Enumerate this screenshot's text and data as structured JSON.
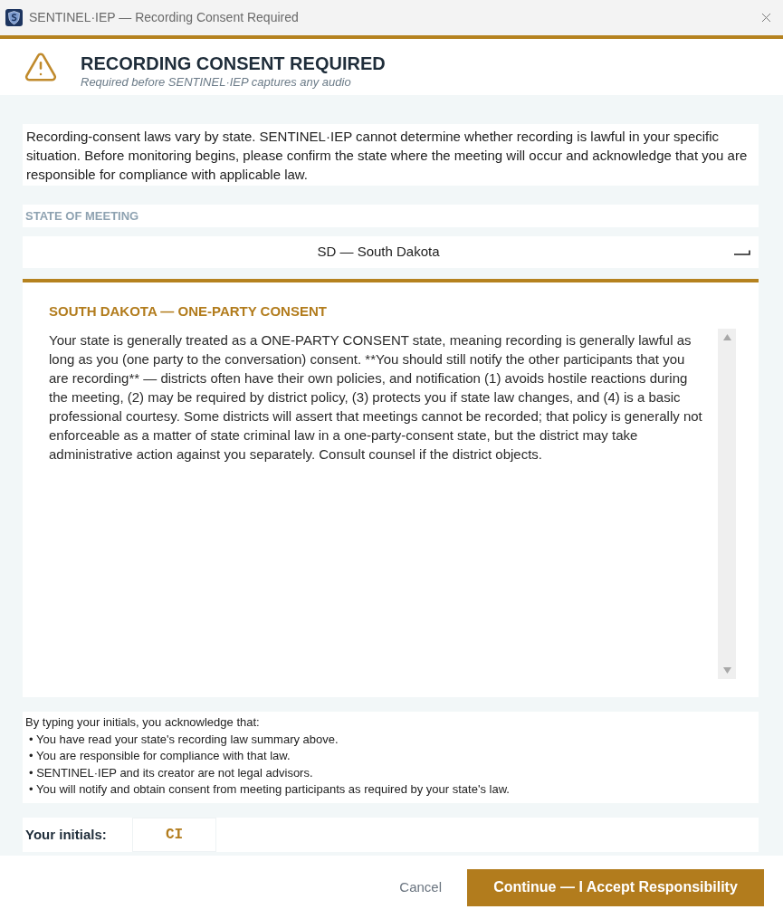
{
  "window": {
    "title": "SENTINEL·IEP — Recording Consent Required"
  },
  "header": {
    "title": "RECORDING CONSENT REQUIRED",
    "subtitle": "Required before SENTINEL·IEP captures any audio"
  },
  "intro": "Recording-consent laws vary by state. SENTINEL·IEP cannot determine whether recording is lawful in your specific situation. Before monitoring begins, please confirm the state where the meeting will occur and acknowledge that you are responsible for compliance with applicable law.",
  "state_field": {
    "label": "STATE OF MEETING",
    "value": "SD — South Dakota"
  },
  "summary": {
    "title": "SOUTH DAKOTA — ONE-PARTY CONSENT",
    "body": "Your state is generally treated as a ONE-PARTY CONSENT state, meaning recording is generally lawful as long as you (one party to the conversation) consent. **You should still notify the other participants that you are recording** — districts often have their own policies, and notification (1) avoids hostile reactions during the meeting, (2) may be required by district policy, (3) protects you if state law changes, and (4) is a basic professional courtesy. Some districts will assert that meetings cannot be recorded; that policy is generally not enforceable as a matter of state criminal law in a one-party-consent state, but the district may take administrative action against you separately. Consult counsel if the district objects."
  },
  "acknowledgement": {
    "lead": "By typing your initials, you acknowledge that:",
    "items": [
      "• You have read your state's recording law summary above.",
      "• You are responsible for compliance with that law.",
      "• SENTINEL·IEP and its creator are not legal advisors.",
      "• You will notify and obtain consent from meeting participants as required by your state's law."
    ]
  },
  "initials": {
    "label": "Your initials:",
    "value": "CI"
  },
  "buttons": [
    {
      "label": "Cancel",
      "kind": "secondary"
    },
    {
      "label": "Continue — I Accept Responsibility",
      "kind": "primary"
    }
  ]
}
